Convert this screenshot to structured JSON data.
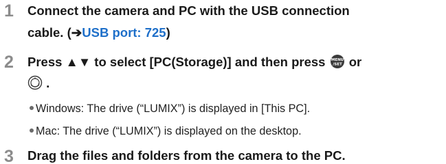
{
  "steps": [
    {
      "number": "1",
      "line1": "Connect the camera and PC with the USB connection",
      "line2_prefix": "cable. (",
      "line2_arrow": "➔",
      "line2_link": "USB port: 725",
      "line2_suffix": ")"
    },
    {
      "number": "2",
      "line1_text": "Press ▲▼ to select [PC(Storage)] and then press ",
      "line1_or": " or",
      "line2_suffix": " .",
      "icons": [
        "menu-set-button-icon",
        "control-dial-icon"
      ],
      "bullets": [
        "Windows: The drive (“LUMIX”) is displayed in [This PC].",
        "Mac: The drive (“LUMIX”) is displayed on the desktop."
      ]
    },
    {
      "number": "3",
      "line1": "Drag the files and folders from the camera to the PC."
    }
  ],
  "colors": {
    "step_number": "#8c8c8c",
    "link": "#1e6fc9",
    "text": "#1a1a1a"
  }
}
